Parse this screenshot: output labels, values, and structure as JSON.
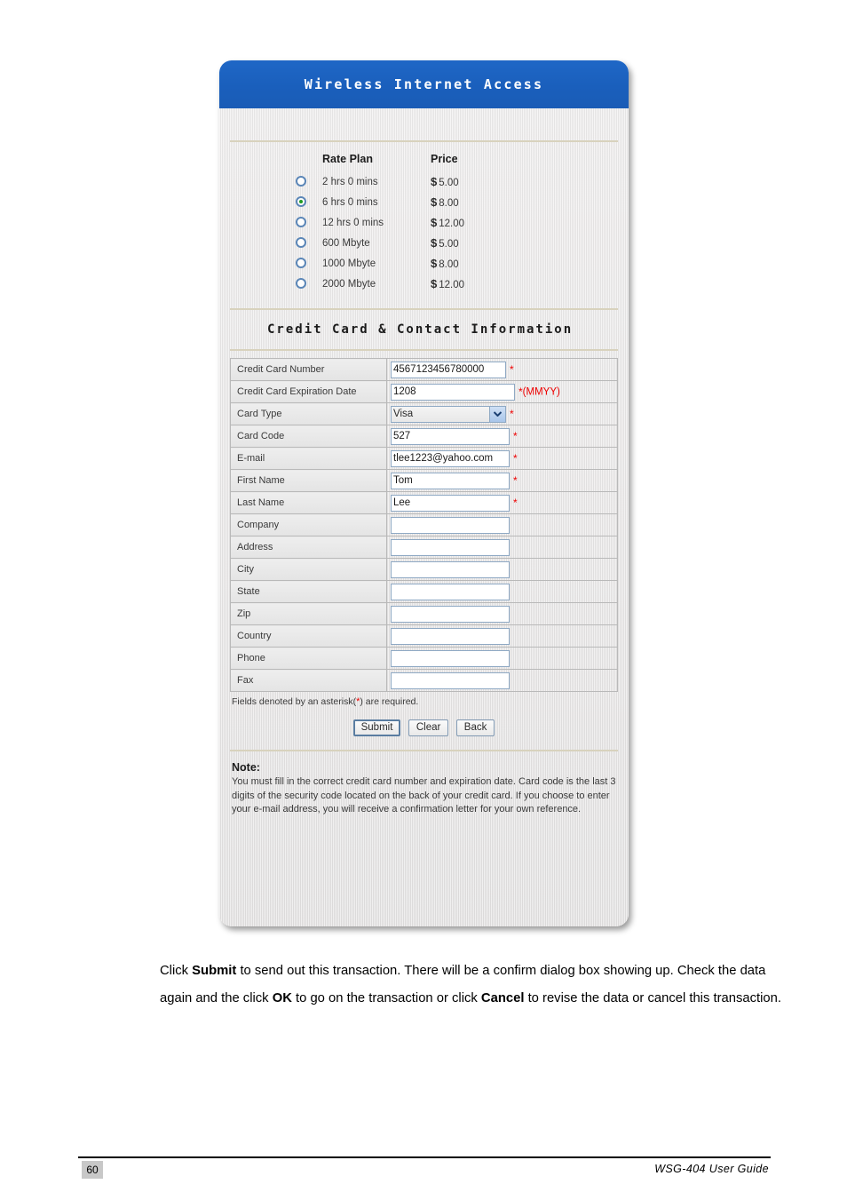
{
  "panel": {
    "title": "Wireless Internet Access",
    "section_heading": "Credit Card & Contact Information",
    "plans_header": {
      "plan": "Rate Plan",
      "price": "Price"
    },
    "plans": [
      {
        "label": "2 hrs 0 mins",
        "currency": "$",
        "price": "5.00",
        "selected": false
      },
      {
        "label": "6 hrs 0 mins",
        "currency": "$",
        "price": "8.00",
        "selected": true
      },
      {
        "label": "12 hrs 0 mins",
        "currency": "$",
        "price": "12.00",
        "selected": false
      },
      {
        "label": "600 Mbyte",
        "currency": "$",
        "price": "5.00",
        "selected": false
      },
      {
        "label": "1000 Mbyte",
        "currency": "$",
        "price": "8.00",
        "selected": false
      },
      {
        "label": "2000 Mbyte",
        "currency": "$",
        "price": "12.00",
        "selected": false
      }
    ],
    "fields": {
      "credit_card_number": {
        "label": "Credit Card Number",
        "value": "4567123456780000"
      },
      "expiration_date": {
        "label": "Credit Card Expiration Date",
        "value": "1208",
        "hint": "(MMYY)"
      },
      "card_type": {
        "label": "Card Type",
        "value": "Visa"
      },
      "card_code": {
        "label": "Card Code",
        "value": "527"
      },
      "email": {
        "label": "E-mail",
        "value": "tlee1223@yahoo.com"
      },
      "first_name": {
        "label": "First Name",
        "value": "Tom"
      },
      "last_name": {
        "label": "Last Name",
        "value": "Lee"
      },
      "company": {
        "label": "Company",
        "value": ""
      },
      "address": {
        "label": "Address",
        "value": ""
      },
      "city": {
        "label": "City",
        "value": ""
      },
      "state": {
        "label": "State",
        "value": ""
      },
      "zip": {
        "label": "Zip",
        "value": ""
      },
      "country": {
        "label": "Country",
        "value": ""
      },
      "phone": {
        "label": "Phone",
        "value": ""
      },
      "fax": {
        "label": "Fax",
        "value": ""
      }
    },
    "required_marker": "*",
    "required_note_before": "Fields denoted by an asterisk(",
    "required_note_after": ") are required.",
    "buttons": {
      "submit": "Submit",
      "clear": "Clear",
      "back": "Back"
    },
    "note_heading": "Note:",
    "note_text": "You must fill in the correct credit card number and expiration date. Card code is the last 3 digits of the security code located on the back of your credit card. If you choose to enter your e-mail address, you will receive a confirmation letter for your own reference."
  },
  "prose": {
    "p1_a": "Click ",
    "p1_b": "Submit",
    "p1_c": " to send out this transaction. There will be a confirm dialog box showing up. Check the data again and the click ",
    "p1_d": "OK",
    "p1_e": " to go on the transaction or click ",
    "p1_f": "Cancel",
    "p1_g": " to revise the data or cancel this transaction."
  },
  "footer": {
    "page_number": "60",
    "guide_title": "WSG-404 User Guide"
  },
  "colors": {
    "header_blue": "#1a5fbc",
    "required_red": "#ee0000",
    "radio_selected_green": "#1f9b22",
    "panel_gray": "#e6e4e4",
    "page_number_bg": "#c8c8c8"
  }
}
